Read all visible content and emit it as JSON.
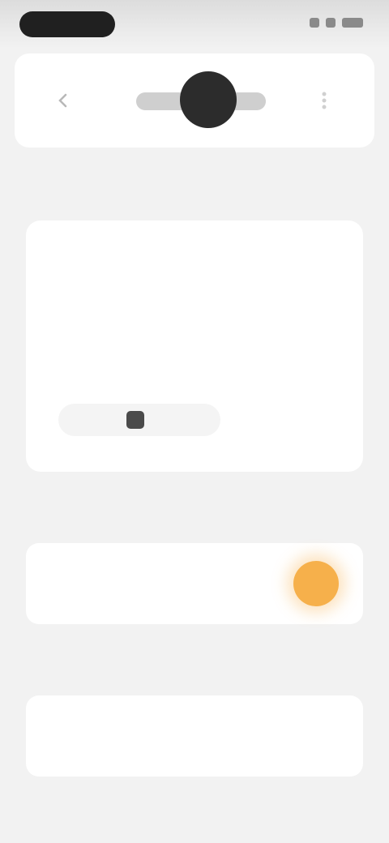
{
  "header": {
    "back_icon": "chevron-left-icon",
    "menu_icon": "more-vertical-icon"
  },
  "main": {
    "section_label": "",
    "time_display": "",
    "sub_line_1": "",
    "sub_line_2": "",
    "action_label": ""
  },
  "settings": {
    "section_label": "",
    "row_title": "",
    "row_subtitle": "",
    "toggle_state": "on",
    "accent_color": "#f6b04b"
  },
  "extra": {
    "section_label": "",
    "row_title": "",
    "row_subtitle": ""
  }
}
